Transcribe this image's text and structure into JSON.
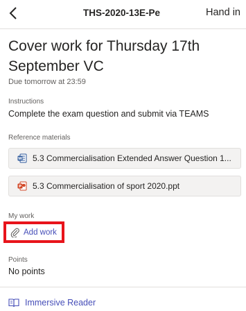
{
  "header": {
    "title": "THS-2020-13E-Pe",
    "hand_in_label": "Hand in"
  },
  "assignment": {
    "title": "Cover work for Thursday 17th September VC",
    "due": "Due tomorrow at 23:59"
  },
  "instructions": {
    "label": "Instructions",
    "text": "Complete the exam question and submit via TEAMS"
  },
  "reference_materials": {
    "label": "Reference materials",
    "items": [
      {
        "name": "5.3 Commercialisation Extended Answer Question 1...",
        "icon": "word-doc-icon",
        "color": "#2b579a"
      },
      {
        "name": "5.3 Commercialisation of sport 2020.ppt",
        "icon": "powerpoint-icon",
        "color": "#d24726"
      }
    ]
  },
  "my_work": {
    "label": "My work",
    "add_work_label": "Add work",
    "highlight_color": "#e8141b"
  },
  "points": {
    "label": "Points",
    "value": "No points"
  },
  "footer": {
    "immersive_reader_label": "Immersive Reader"
  },
  "colors": {
    "accent": "#464eb8",
    "text": "#252423",
    "secondary_text": "#605e5c"
  }
}
